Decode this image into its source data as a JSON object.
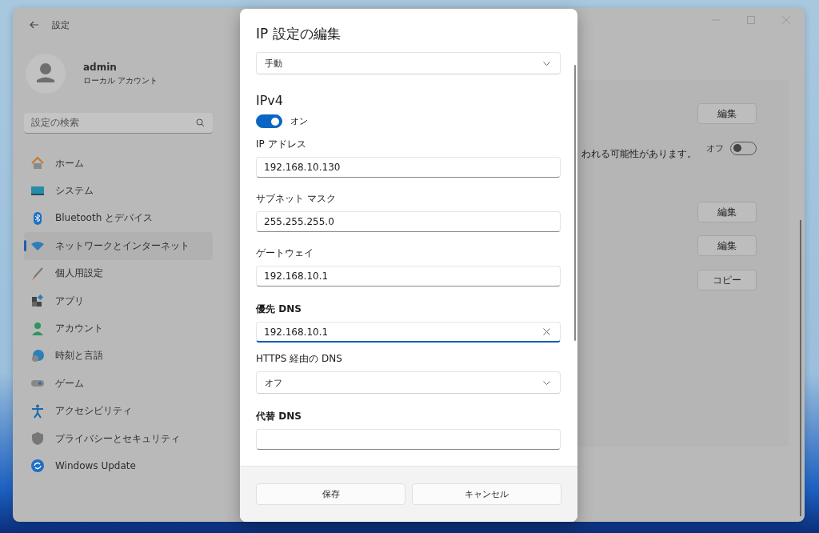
{
  "window": {
    "title": "設定"
  },
  "account": {
    "name": "admin",
    "type": "ローカル アカウント"
  },
  "search": {
    "placeholder": "設定の検索"
  },
  "nav": [
    {
      "label": "ホーム",
      "selected": false
    },
    {
      "label": "システム",
      "selected": false
    },
    {
      "label": "Bluetooth とデバイス",
      "selected": false
    },
    {
      "label": "ネットワークとインターネット",
      "selected": true
    },
    {
      "label": "個人用設定",
      "selected": false
    },
    {
      "label": "アプリ",
      "selected": false
    },
    {
      "label": "アカウント",
      "selected": false
    },
    {
      "label": "時刻と言語",
      "selected": false
    },
    {
      "label": "ゲーム",
      "selected": false
    },
    {
      "label": "アクセシビリティ",
      "selected": false
    },
    {
      "label": "プライバシーとセキュリティ",
      "selected": false
    },
    {
      "label": "Windows Update",
      "selected": false
    }
  ],
  "panel_rows": [
    {
      "kind": "button",
      "label": "編集"
    },
    {
      "kind": "toggle",
      "description": "われる可能性があります。",
      "state_label": "オフ",
      "on": false
    },
    {
      "kind": "button",
      "label": "編集"
    },
    {
      "kind": "button",
      "label": "編集"
    },
    {
      "kind": "button",
      "label": "コピー"
    }
  ],
  "dialog": {
    "title": "IP 設定の編集",
    "mode": "手動",
    "section": "IPv4",
    "toggle": {
      "on": true,
      "label": "オン"
    },
    "items": [
      {
        "kind": "label",
        "text": "IP アドレス"
      },
      {
        "kind": "input",
        "value": "192.168.10.130",
        "focused": false
      },
      {
        "kind": "label",
        "text": "サブネット マスク"
      },
      {
        "kind": "input",
        "value": "255.255.255.0",
        "focused": false
      },
      {
        "kind": "label",
        "text": "ゲートウェイ"
      },
      {
        "kind": "input",
        "value": "192.168.10.1",
        "focused": false
      },
      {
        "kind": "heading",
        "text": "優先 DNS"
      },
      {
        "kind": "input",
        "value": "192.168.10.1",
        "focused": true
      },
      {
        "kind": "label",
        "text": "HTTPS 経由の DNS"
      },
      {
        "kind": "dropdown",
        "value": "オフ"
      },
      {
        "kind": "heading",
        "text": "代替 DNS"
      },
      {
        "kind": "input",
        "focused": false
      }
    ],
    "buttons": [
      "保存",
      "キャンセル"
    ]
  }
}
